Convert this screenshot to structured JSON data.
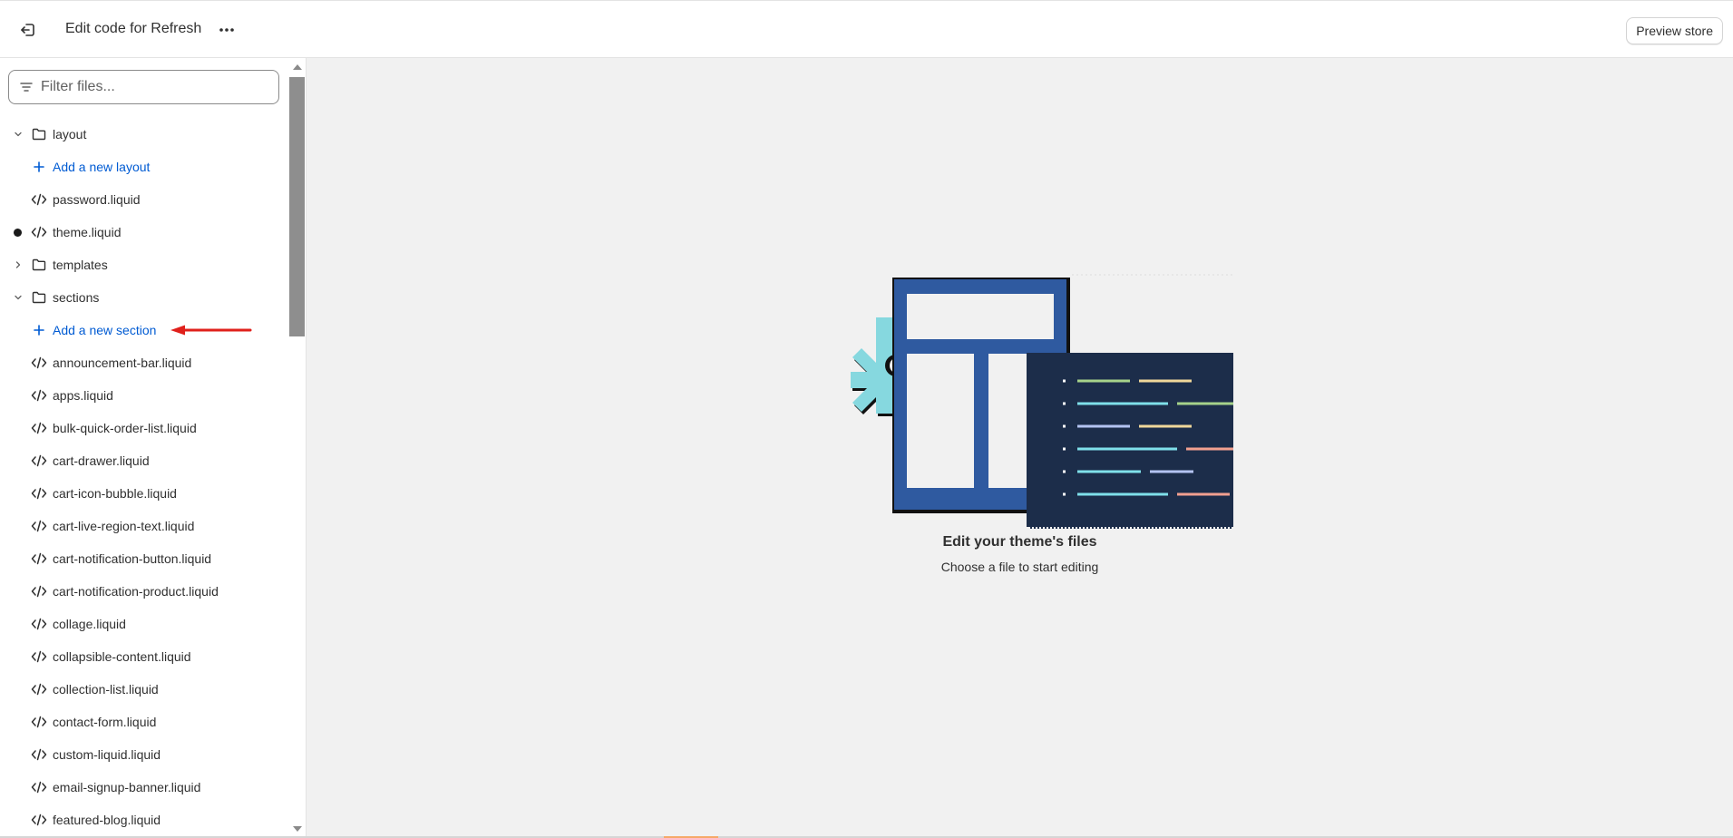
{
  "header": {
    "exit_icon": "exit-arrow-icon",
    "title": "Edit code for Refresh",
    "more_icon": "horizontal-dots-icon",
    "preview_label": "Preview store"
  },
  "sidebar": {
    "filter_placeholder": "Filter files...",
    "filter_value": "",
    "tree": [
      {
        "type": "folder",
        "label": "layout",
        "expanded": true
      },
      {
        "type": "add",
        "label": "Add a new layout"
      },
      {
        "type": "file",
        "label": "password.liquid",
        "modified": false
      },
      {
        "type": "file",
        "label": "theme.liquid",
        "modified": true
      },
      {
        "type": "folder",
        "label": "templates",
        "expanded": false
      },
      {
        "type": "folder",
        "label": "sections",
        "expanded": true
      },
      {
        "type": "add",
        "label": "Add a new section",
        "annotated": true
      },
      {
        "type": "file",
        "label": "announcement-bar.liquid"
      },
      {
        "type": "file",
        "label": "apps.liquid"
      },
      {
        "type": "file",
        "label": "bulk-quick-order-list.liquid"
      },
      {
        "type": "file",
        "label": "cart-drawer.liquid"
      },
      {
        "type": "file",
        "label": "cart-icon-bubble.liquid"
      },
      {
        "type": "file",
        "label": "cart-live-region-text.liquid"
      },
      {
        "type": "file",
        "label": "cart-notification-button.liquid"
      },
      {
        "type": "file",
        "label": "cart-notification-product.liquid"
      },
      {
        "type": "file",
        "label": "collage.liquid"
      },
      {
        "type": "file",
        "label": "collapsible-content.liquid"
      },
      {
        "type": "file",
        "label": "collection-list.liquid"
      },
      {
        "type": "file",
        "label": "contact-form.liquid"
      },
      {
        "type": "file",
        "label": "custom-liquid.liquid"
      },
      {
        "type": "file",
        "label": "email-signup-banner.liquid"
      },
      {
        "type": "file",
        "label": "featured-blog.liquid"
      }
    ]
  },
  "colors": {
    "accent_link": "#005bd3",
    "annotation_arrow": "#e0201b",
    "illus_blue": "#2f5aa0",
    "illus_navy": "#1c2d4a",
    "illus_cyan": "#86d8df"
  },
  "main": {
    "empty_title": "Edit your theme's files",
    "empty_subtitle": "Choose a file to start editing"
  }
}
